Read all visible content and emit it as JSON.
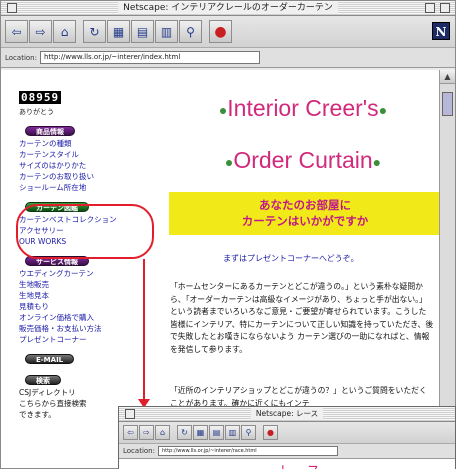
{
  "window": {
    "title": "Netscape: インテリアクレールのオーダーカーテン"
  },
  "toolbar": {
    "icons": [
      "back-icon",
      "forward-icon",
      "home-icon",
      "reload-icon",
      "images-icon",
      "open-icon",
      "print-icon",
      "find-icon",
      "stop-icon"
    ],
    "back_glyph": "⇦",
    "forward_glyph": "⇨",
    "home_glyph": "⌂",
    "reload_glyph": "↻",
    "images_glyph": "▦",
    "open_glyph": "▤",
    "print_glyph": "▥",
    "find_glyph": "⚲",
    "stop_glyph": "●",
    "logo": "N"
  },
  "location": {
    "label": "Location:",
    "url": "http://www.lls.or.jp/~interer/index.html"
  },
  "sidebar": {
    "counter": "08959",
    "thanks": "ありがとう",
    "section1": {
      "label": "商品情報",
      "items": [
        "カーテンの種類",
        "カーテンスタイル",
        "サイズのはかりかた",
        "カーテンのお取り扱い",
        "ショールーム所在地"
      ]
    },
    "section2": {
      "label": "カーテン図鑑",
      "items": [
        "カーテンベストコレクション",
        "アクセサリー",
        "OUR WORKS"
      ]
    },
    "section3": {
      "label": "サービス情報",
      "items": [
        "ウエディングカーテン",
        "生地販売",
        "生地見本",
        "見積もり",
        "オンライン価格で購入",
        "販売価格・お支払い方法",
        "プレゼントコーナー"
      ]
    },
    "section4": {
      "label": "E-MAIL"
    },
    "section5": {
      "label": "検索",
      "items": [
        "CSJディレクトリ",
        "こちらから直接検索",
        "できます。"
      ]
    }
  },
  "main": {
    "title1": "Interior Creer's",
    "title2": "Order Curtain",
    "banner_line1": "あなたのお部屋に",
    "banner_line2": "カーテンはいかがですか",
    "present_link": "まずはプレゼントコーナーへどうぞ。",
    "para1": "「ホームセンターにあるカーテンとどこが違うの。」という素朴な疑問から、「オーダーカーテンは高級なイメージがあり、ちょっと手が出ない。」という読者までいろいろなご意見・ご要望が寄せられています。こうした皆様にインテリア、特にカーテンについて正しい知識を持っていただき、後で失敗したとお嘆きにならないよう カーテン選びの一助になればと、情報を発信して参ります。",
    "para2": "「近所のインテリアショップとどこが違うの？」というご質問をいただくことがあります。確かに近くにもインテ"
  },
  "window2": {
    "title": "Netscape: レース",
    "url": "http://www.lls.or.jp/~interer/race.html",
    "heading": "レース"
  },
  "colors": {
    "accent_pink": "#d12a7c",
    "banner_yellow": "#f2ea18",
    "link_blue": "#1a1aa8",
    "highlight_red": "#e31e2c"
  }
}
